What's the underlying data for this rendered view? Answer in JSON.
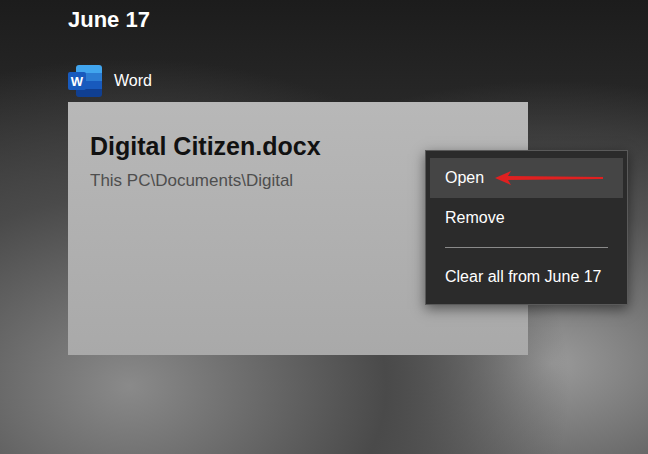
{
  "timeline": {
    "date": "June 17"
  },
  "app": {
    "name": "Word",
    "icon_letter": "W"
  },
  "card": {
    "title": "Digital Citizen.docx",
    "path": "This PC\\Documents\\Digital"
  },
  "context_menu": {
    "items": [
      {
        "kind": "item",
        "label": "Open",
        "selected": true
      },
      {
        "kind": "item",
        "label": "Remove",
        "selected": false
      },
      {
        "kind": "separator"
      },
      {
        "kind": "item",
        "label": "Clear all from June 17",
        "selected": false
      }
    ]
  },
  "annotations": [
    {
      "kind": "arrow",
      "points_to": "Open",
      "color": "#e02020"
    }
  ]
}
